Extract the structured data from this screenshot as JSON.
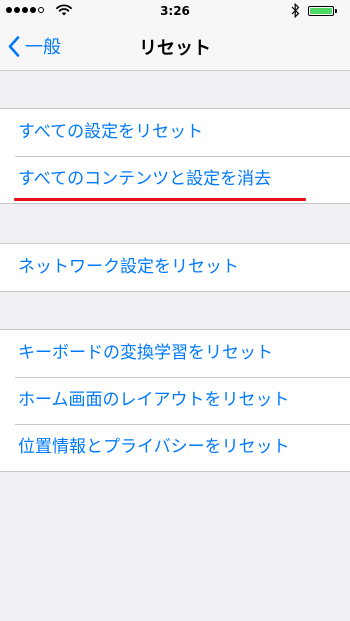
{
  "status_bar": {
    "time": "3:26",
    "signal_icon": "signal-dots-icon",
    "wifi_icon": "wifi-icon",
    "bluetooth_icon": "bluetooth-icon",
    "battery_icon": "battery-icon",
    "battery_level": 1.0,
    "battery_color": "#4cd964"
  },
  "nav_bar": {
    "back_label": "一般",
    "back_icon": "chevron-left-icon",
    "title": "リセット"
  },
  "groups": [
    {
      "items": [
        "すべての設定をリセット",
        "すべてのコンテンツと設定を消去"
      ]
    },
    {
      "items": [
        "ネットワーク設定をリセット"
      ]
    },
    {
      "items": [
        "キーボードの変換学習をリセット",
        "ホーム画面のレイアウトをリセット",
        "位置情報とプライバシーをリセット"
      ]
    }
  ],
  "colors": {
    "accent": "#007aff",
    "background": "#efeff4",
    "highlight_underline": "#e41019"
  }
}
